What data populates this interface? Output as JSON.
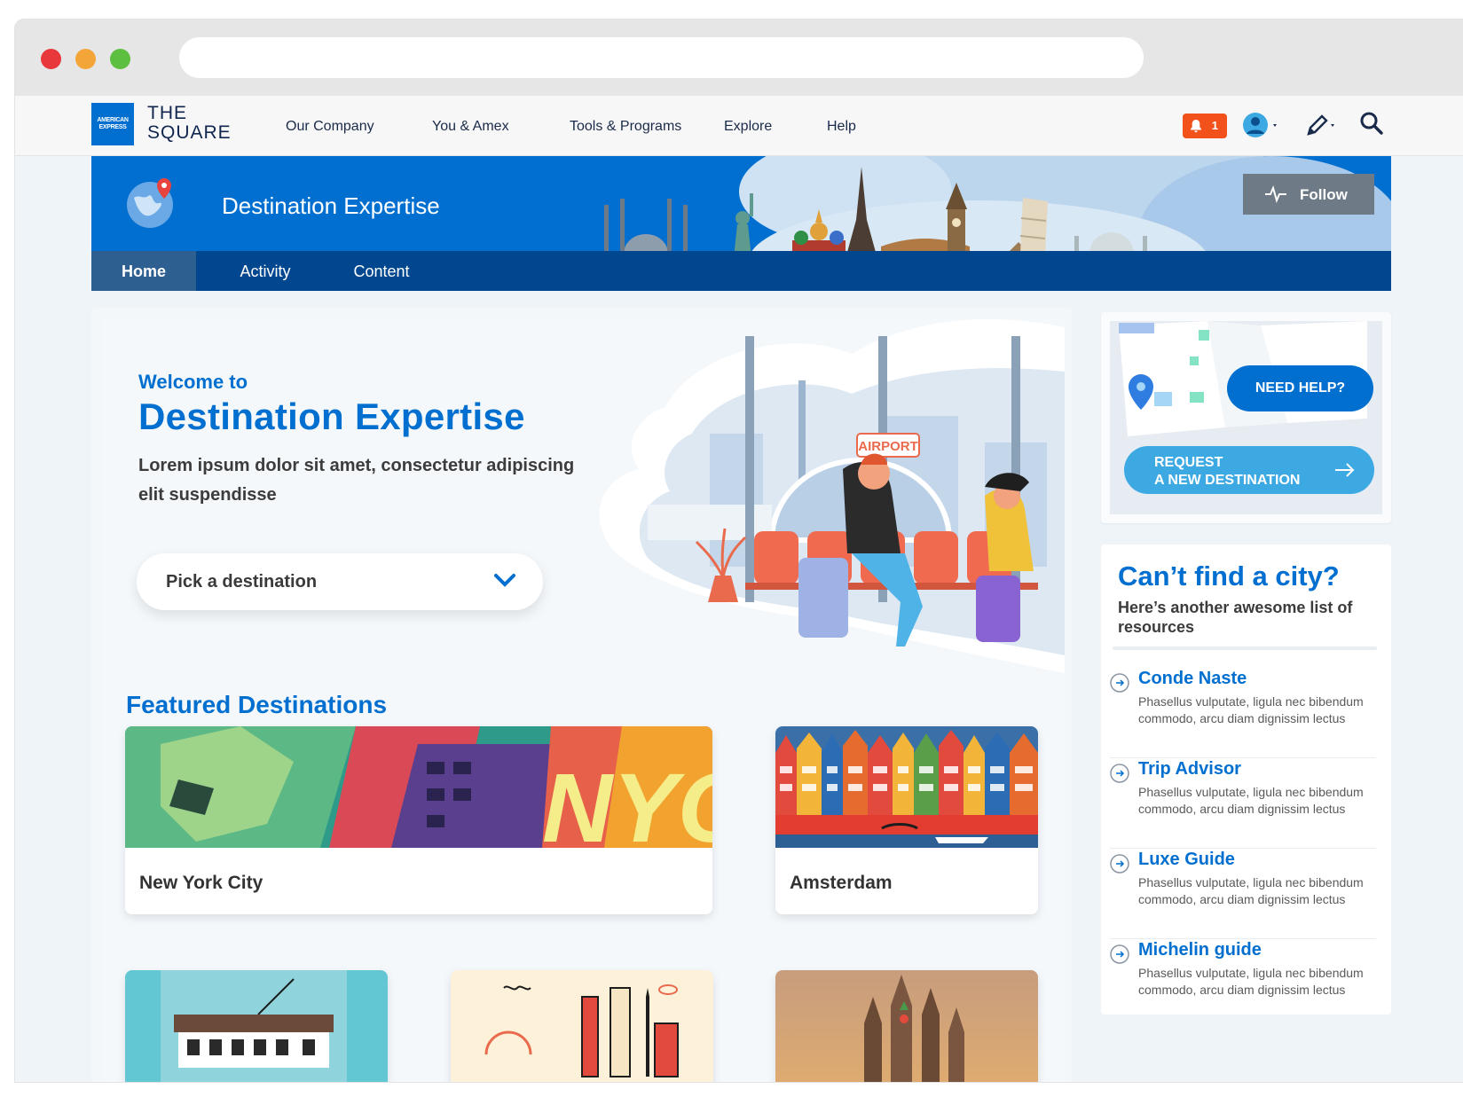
{
  "nav": {
    "logo_mark": "AMERICAN EXPRESS",
    "logo_line1": "THE",
    "logo_line2": "SQUARE",
    "links": [
      "Our Company",
      "You & Amex",
      "Tools & Programs",
      "Explore",
      "Help"
    ],
    "notification_count": "1",
    "icons": [
      "bell-icon",
      "avatar-icon",
      "pencil-icon",
      "search-icon"
    ]
  },
  "banner": {
    "title": "Destination Expertise",
    "follow_label": "Follow",
    "tabs": [
      "Home",
      "Activity",
      "Content"
    ],
    "active_tab": "Home"
  },
  "hero": {
    "welcome": "Welcome to",
    "title": "Destination Expertise",
    "subtitle": "Lorem ipsum dolor sit amet, consectetur adipiscing elit suspendisse",
    "dropdown_value": "Pick a destination",
    "sign_text": "AIRPORT"
  },
  "featured": {
    "heading": "Featured Destinations",
    "cards": [
      {
        "label": "New York City",
        "art": "NYC"
      },
      {
        "label": "Amsterdam"
      }
    ]
  },
  "help": {
    "need_help": "NEED HELP?",
    "request_line1": "REQUEST",
    "request_line2": "A NEW DESTINATION"
  },
  "resources": {
    "title": "Can’t find a city?",
    "subtitle": "Here’s another awesome list of resources",
    "items": [
      {
        "title": "Conde Naste",
        "desc": "Phasellus vulputate, ligula nec bibendum commodo, arcu diam dignissim lectus"
      },
      {
        "title": "Trip Advisor",
        "desc": "Phasellus vulputate, ligula nec bibendum commodo, arcu diam dignissim lectus"
      },
      {
        "title": "Luxe Guide",
        "desc": "Phasellus vulputate, ligula nec bibendum commodo, arcu diam dignissim lectus"
      },
      {
        "title": "Michelin guide",
        "desc": "Phasellus vulputate, ligula nec bibendum commodo, arcu diam dignissim lectus"
      }
    ]
  },
  "colors": {
    "brand_blue": "#006fcf",
    "banner_blue": "#016fd0",
    "subnav_blue": "#00478f",
    "notification_orange": "#f2511b",
    "light_blue": "#3da9e3"
  }
}
